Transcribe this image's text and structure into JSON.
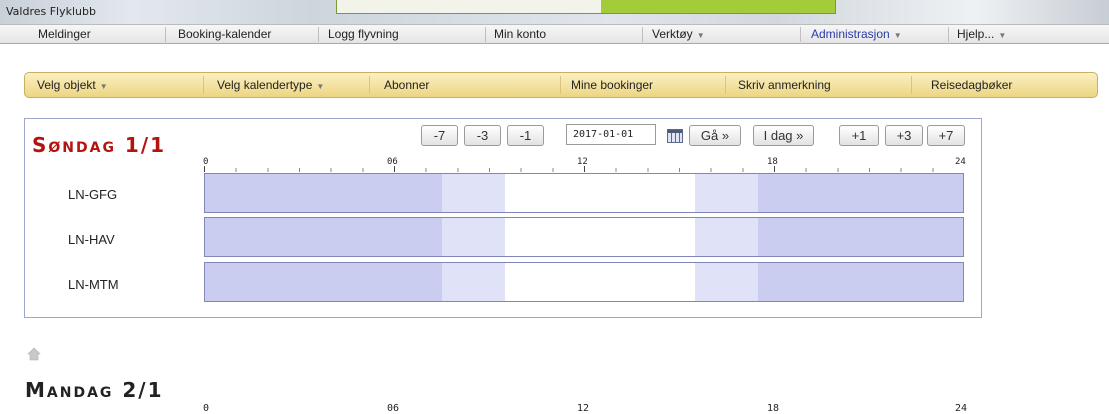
{
  "site": {
    "title": "Valdres Flyklubb"
  },
  "main_nav": [
    {
      "label": "Meldinger"
    },
    {
      "label": "Booking-kalender"
    },
    {
      "label": "Logg flyvning"
    },
    {
      "label": "Min konto"
    },
    {
      "label": "Verktøy",
      "dropdown": true
    },
    {
      "label": "Administrasjon",
      "dropdown": true
    },
    {
      "label": "Hjelp...",
      "dropdown": true
    }
  ],
  "sub_nav": [
    {
      "label": "Velg objekt",
      "dropdown": true
    },
    {
      "label": "Velg kalendertype",
      "dropdown": true
    },
    {
      "label": "Abonner"
    },
    {
      "label": "Mine bookinger"
    },
    {
      "label": "Skriv anmerkning"
    },
    {
      "label": "Reisedagbøker"
    }
  ],
  "date_nav": {
    "minus7": "-7",
    "minus3": "-3",
    "minus1": "-1",
    "date_value": "2017-01-01",
    "go": "Gå »",
    "today": "I dag »",
    "plus1": "+1",
    "plus3": "+3",
    "plus7": "+7"
  },
  "days": [
    {
      "title": "Søndag 1/1",
      "axis_ticks": [
        "0",
        "06",
        "12",
        "18",
        "24"
      ],
      "aircraft": [
        "LN-GFG",
        "LN-HAV",
        "LN-MTM"
      ],
      "daylight": {
        "night_until_hour": 7.5,
        "twilight_until_hour": 9.5,
        "day_until_hour": 15.5,
        "twilight_until_hour_end": 17.5
      }
    },
    {
      "title": "Mandag 2/1",
      "axis_ticks": [
        "0",
        "06",
        "12",
        "18",
        "24"
      ]
    }
  ],
  "colors": {
    "night": "#cacdf0",
    "twilight": "#e0e2f7",
    "day": "#ffffff",
    "day_title": "#b3140f",
    "subnav_bg": "#f3e1a0"
  },
  "icons": {
    "calendar": "calendar-icon",
    "home": "home-icon"
  }
}
